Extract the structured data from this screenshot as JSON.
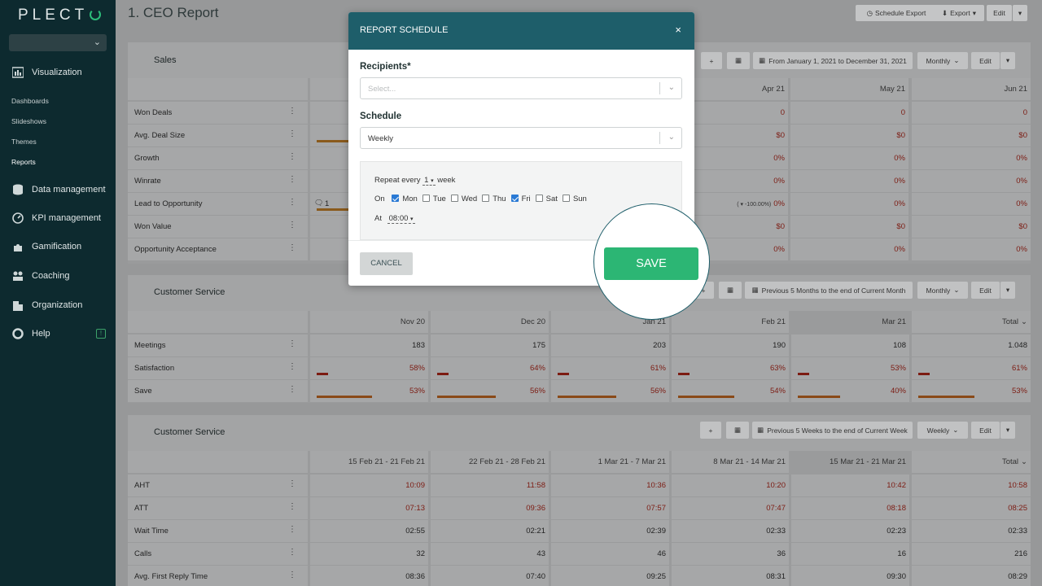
{
  "sidebar": {
    "logo": "PLECT",
    "nav": [
      {
        "label": "Visualization",
        "icon": "chart-icon"
      },
      {
        "label": "Data management",
        "icon": "database-icon"
      },
      {
        "label": "KPI management",
        "icon": "gauge-icon"
      },
      {
        "label": "Gamification",
        "icon": "puzzle-icon"
      },
      {
        "label": "Coaching",
        "icon": "people-icon"
      },
      {
        "label": "Organization",
        "icon": "building-icon"
      },
      {
        "label": "Help",
        "icon": "lifebuoy-icon"
      }
    ],
    "sub_items": [
      "Dashboards",
      "Slideshows",
      "Themes",
      "Reports"
    ],
    "active_sub": "Reports",
    "help_badge": "!"
  },
  "topbar": {
    "title": "1. CEO Report",
    "schedule_export": "Schedule Export",
    "export": "Export",
    "edit": "Edit"
  },
  "panels": {
    "sales": {
      "title": "Sales",
      "add": "+",
      "date_range": "From January 1, 2021 to December 31, 2021",
      "period": "Monthly",
      "edit": "Edit",
      "columns": [
        "Apr 21",
        "May 21",
        "Jun 21"
      ],
      "rows": [
        {
          "label": "Won Deals",
          "values": [
            "0",
            "0",
            "0"
          ]
        },
        {
          "label": "Avg. Deal Size",
          "values": [
            "$0",
            "$0",
            "$0"
          ]
        },
        {
          "label": "Growth",
          "values": [
            "0%",
            "0%",
            "0%"
          ]
        },
        {
          "label": "Winrate",
          "values": [
            "0%",
            "0%",
            "0%"
          ]
        },
        {
          "label": "Lead to Opportunity",
          "values": [
            "0%",
            "0%",
            "0%"
          ],
          "comment_count": "1",
          "delta": "( ▾ -100.00%)"
        },
        {
          "label": "Won Value",
          "values": [
            "$0",
            "$0",
            "$0"
          ]
        },
        {
          "label": "Opportunity Acceptance",
          "values": [
            "0%",
            "0%",
            "0%"
          ]
        }
      ]
    },
    "service_monthly": {
      "title": "Customer Service",
      "add": "+",
      "date_range": "Previous 5 Months to the end of Current Month",
      "period": "Monthly",
      "edit": "Edit",
      "columns": [
        "Nov 20",
        "Dec 20",
        "Jan 21",
        "Feb 21",
        "Mar 21",
        "Total"
      ],
      "rows": [
        {
          "label": "Meetings",
          "values": [
            "183",
            "175",
            "203",
            "190",
            "108",
            "1.048"
          ]
        },
        {
          "label": "Satisfaction",
          "values": [
            "58%",
            "64%",
            "61%",
            "63%",
            "53%",
            "61%"
          ],
          "bars": [
            0.1,
            0.1,
            0.1,
            0.1,
            0.1,
            0.1
          ]
        },
        {
          "label": "Save",
          "values": [
            "53%",
            "56%",
            "56%",
            "54%",
            "40%",
            "53%"
          ],
          "bars": [
            0.53,
            0.56,
            0.56,
            0.54,
            0.4,
            0.53
          ]
        }
      ]
    },
    "service_weekly": {
      "title": "Customer Service",
      "add": "+",
      "date_range": "Previous 5 Weeks to the end of Current Week",
      "period": "Weekly",
      "edit": "Edit",
      "columns": [
        "15 Feb 21 - 21 Feb 21",
        "22 Feb 21 - 28 Feb 21",
        "1 Mar 21 - 7 Mar 21",
        "8 Mar 21 - 14 Mar 21",
        "15 Mar 21 - 21 Mar 21",
        "Total"
      ],
      "rows": [
        {
          "label": "AHT",
          "values": [
            "10:09",
            "11:58",
            "10:36",
            "10:20",
            "10:42",
            "10:58"
          ]
        },
        {
          "label": "ATT",
          "values": [
            "07:13",
            "09:36",
            "07:57",
            "07:47",
            "08:18",
            "08:25"
          ]
        },
        {
          "label": "Wait Time",
          "values": [
            "02:55",
            "02:21",
            "02:39",
            "02:33",
            "02:23",
            "02:33"
          ]
        },
        {
          "label": "Calls",
          "values": [
            "32",
            "43",
            "46",
            "36",
            "16",
            "216"
          ]
        },
        {
          "label": "Avg. First Reply Time",
          "values": [
            "08:36",
            "07:40",
            "09:25",
            "08:31",
            "09:30",
            "08:29"
          ]
        }
      ]
    }
  },
  "modal": {
    "title": "REPORT SCHEDULE",
    "close": "×",
    "recipients_label": "Recipients*",
    "recipients_placeholder": "Select...",
    "schedule_label": "Schedule",
    "schedule_value": "Weekly",
    "repeat_every": "Repeat every",
    "repeat_value": "1",
    "repeat_unit": "week",
    "on_label": "On",
    "days": [
      {
        "label": "Mon",
        "checked": true
      },
      {
        "label": "Tue",
        "checked": false
      },
      {
        "label": "Wed",
        "checked": false
      },
      {
        "label": "Thu",
        "checked": false
      },
      {
        "label": "Fri",
        "checked": true
      },
      {
        "label": "Sat",
        "checked": false
      },
      {
        "label": "Sun",
        "checked": false
      }
    ],
    "at_label": "At",
    "time_value": "08:00",
    "cancel": "CANCEL",
    "save": "SAVE"
  }
}
